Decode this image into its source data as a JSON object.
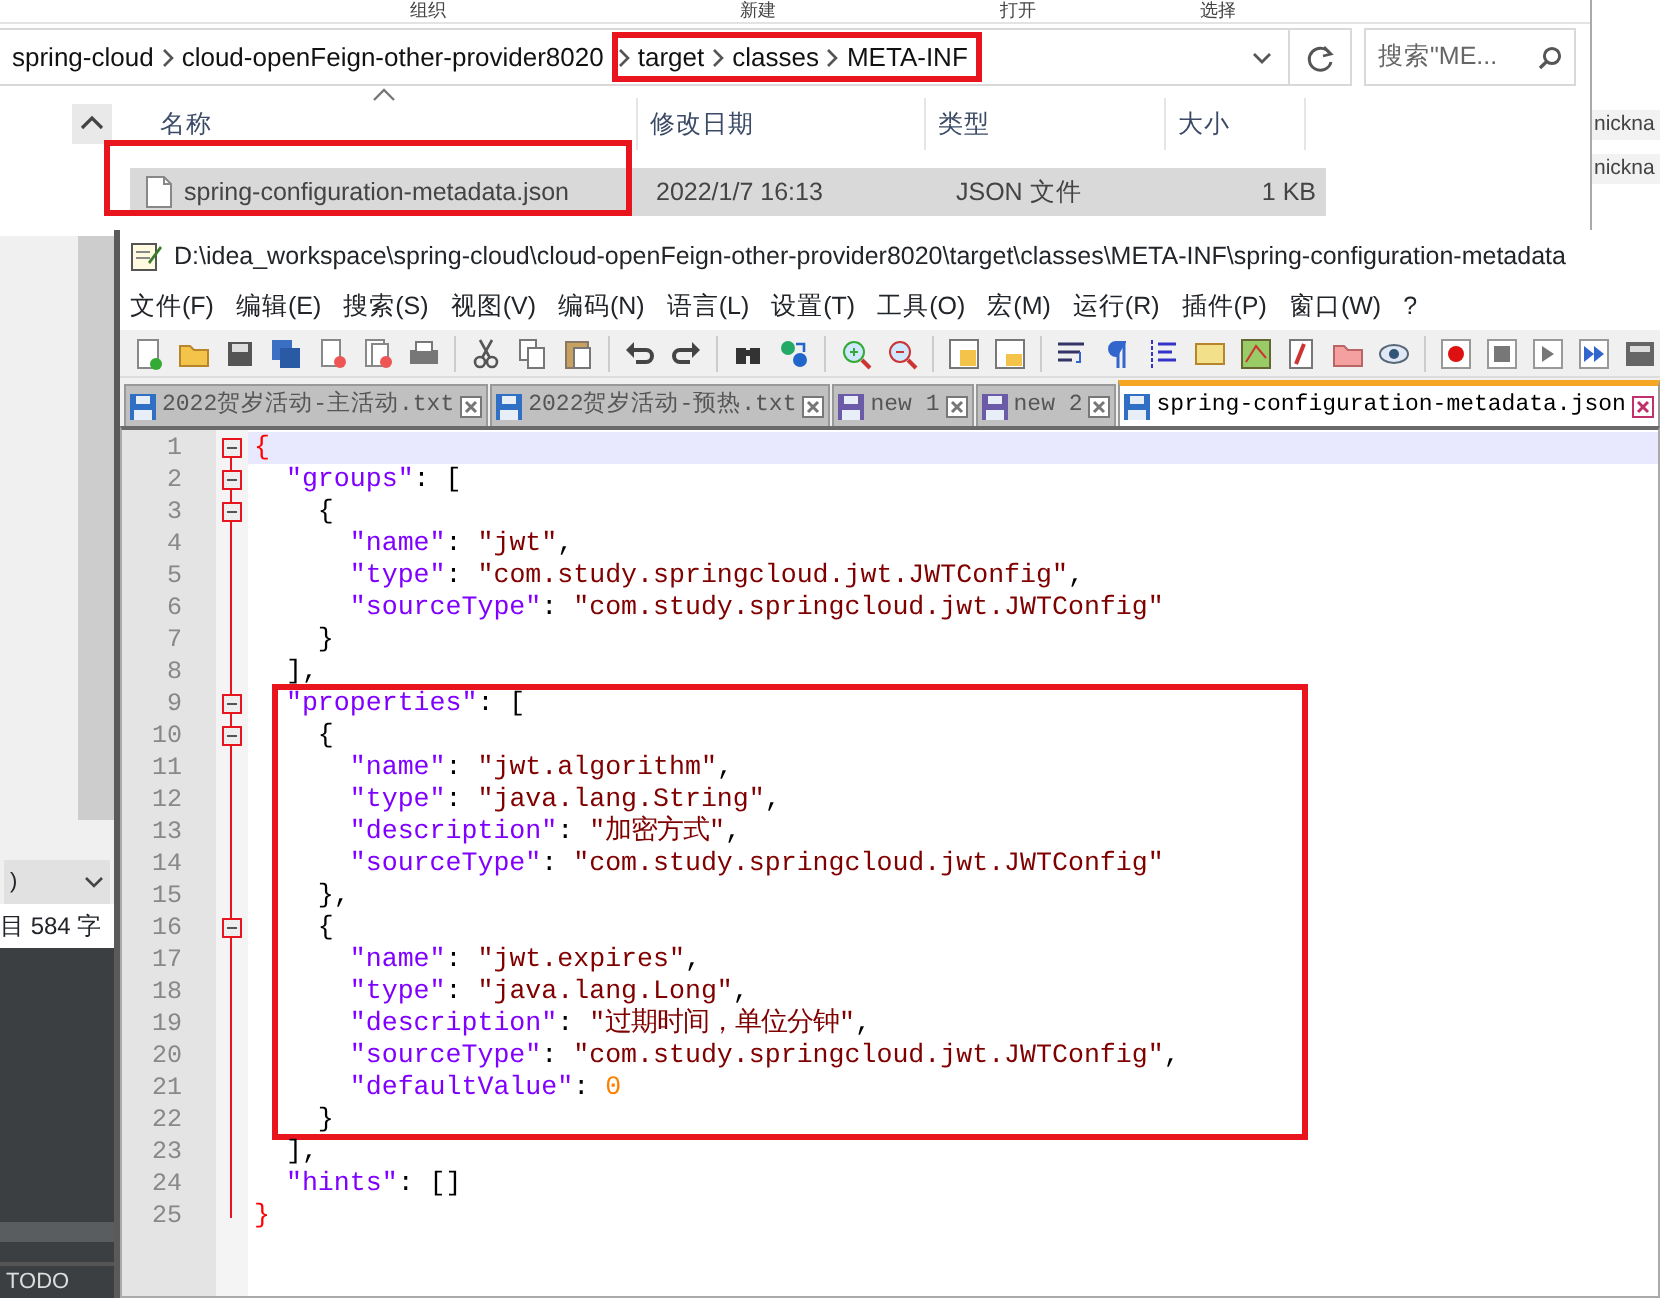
{
  "explorer": {
    "ribbon_labels": [
      "组织",
      "新建",
      "打开",
      "选择"
    ],
    "breadcrumb": [
      {
        "boxed": false,
        "items": [
          "spring-cloud",
          "cloud-openFeign-other-provider8020"
        ]
      },
      {
        "boxed": true,
        "items": [
          "target",
          "classes",
          "META-INF"
        ]
      }
    ],
    "search": {
      "placeholder": "搜索\"ME..."
    },
    "columns": [
      "名称",
      "修改日期",
      "类型",
      "大小"
    ],
    "files": [
      {
        "name": "spring-configuration-metadata.json",
        "modified": "2022/1/7 16:13",
        "type": "JSON 文件",
        "size": "1 KB",
        "selected": true,
        "boxed": true
      }
    ]
  },
  "side_window": {
    "items": [
      "nickna",
      "nickna"
    ]
  },
  "ide_fragment": {
    "dropdown": ")",
    "status": "目 584 字",
    "tool_tab": "TODO"
  },
  "editor": {
    "title": "D:\\idea_workspace\\spring-cloud\\cloud-openFeign-other-provider8020\\target\\classes\\META-INF\\spring-configuration-metadata",
    "menu": [
      "文件(F)",
      "编辑(E)",
      "搜索(S)",
      "视图(V)",
      "编码(N)",
      "语言(L)",
      "设置(T)",
      "工具(O)",
      "宏(M)",
      "运行(R)",
      "插件(P)",
      "窗口(W)",
      "?"
    ],
    "tabs": [
      {
        "label": "2022贺岁活动-主活动.txt",
        "selected": false,
        "saved": true
      },
      {
        "label": "2022贺岁活动-预热.txt",
        "selected": false,
        "saved": true
      },
      {
        "label": "new 1",
        "selected": false,
        "saved": false
      },
      {
        "label": "new 2",
        "selected": false,
        "saved": false
      },
      {
        "label": "spring-configuration-metadata.json",
        "selected": true,
        "saved": true
      }
    ],
    "sections": [
      {
        "boxed": false,
        "lines": [
          {
            "num": "1",
            "foldable": true,
            "current": true,
            "tokens": [
              {
                "kind": "brace",
                "text": "{"
              }
            ]
          },
          {
            "num": "2",
            "foldable": true,
            "current": false,
            "tokens": [
              {
                "kind": "key",
                "text": "  \"groups\""
              },
              {
                "kind": "punct",
                "text": ": ["
              }
            ]
          },
          {
            "num": "3",
            "foldable": true,
            "current": false,
            "tokens": [
              {
                "kind": "punct",
                "text": "    {"
              }
            ]
          },
          {
            "num": "4",
            "foldable": false,
            "current": false,
            "tokens": [
              {
                "kind": "key",
                "text": "      \"name\""
              },
              {
                "kind": "punct",
                "text": ": "
              },
              {
                "kind": "string",
                "text": "\"jwt\""
              },
              {
                "kind": "punct",
                "text": ","
              }
            ]
          },
          {
            "num": "5",
            "foldable": false,
            "current": false,
            "tokens": [
              {
                "kind": "key",
                "text": "      \"type\""
              },
              {
                "kind": "punct",
                "text": ": "
              },
              {
                "kind": "string",
                "text": "\"com.study.springcloud.jwt.JWTConfig\""
              },
              {
                "kind": "punct",
                "text": ","
              }
            ]
          },
          {
            "num": "6",
            "foldable": false,
            "current": false,
            "tokens": [
              {
                "kind": "key",
                "text": "      \"sourceType\""
              },
              {
                "kind": "punct",
                "text": ": "
              },
              {
                "kind": "string",
                "text": "\"com.study.springcloud.jwt.JWTConfig\""
              }
            ]
          },
          {
            "num": "7",
            "foldable": false,
            "current": false,
            "tokens": [
              {
                "kind": "punct",
                "text": "    }"
              }
            ]
          },
          {
            "num": "8",
            "foldable": false,
            "current": false,
            "tokens": [
              {
                "kind": "punct",
                "text": "  ],"
              }
            ]
          }
        ]
      },
      {
        "boxed": true,
        "lines": [
          {
            "num": "9",
            "foldable": true,
            "current": false,
            "tokens": [
              {
                "kind": "key",
                "text": "  \"properties\""
              },
              {
                "kind": "punct",
                "text": ": ["
              }
            ]
          },
          {
            "num": "10",
            "foldable": true,
            "current": false,
            "tokens": [
              {
                "kind": "punct",
                "text": "    {"
              }
            ]
          },
          {
            "num": "11",
            "foldable": false,
            "current": false,
            "tokens": [
              {
                "kind": "key",
                "text": "      \"name\""
              },
              {
                "kind": "punct",
                "text": ": "
              },
              {
                "kind": "string",
                "text": "\"jwt.algorithm\""
              },
              {
                "kind": "punct",
                "text": ","
              }
            ]
          },
          {
            "num": "12",
            "foldable": false,
            "current": false,
            "tokens": [
              {
                "kind": "key",
                "text": "      \"type\""
              },
              {
                "kind": "punct",
                "text": ": "
              },
              {
                "kind": "string",
                "text": "\"java.lang.String\""
              },
              {
                "kind": "punct",
                "text": ","
              }
            ]
          },
          {
            "num": "13",
            "foldable": false,
            "current": false,
            "tokens": [
              {
                "kind": "key",
                "text": "      \"description\""
              },
              {
                "kind": "punct",
                "text": ": "
              },
              {
                "kind": "string",
                "text": "\"加密方式\""
              },
              {
                "kind": "punct",
                "text": ","
              }
            ]
          },
          {
            "num": "14",
            "foldable": false,
            "current": false,
            "tokens": [
              {
                "kind": "key",
                "text": "      \"sourceType\""
              },
              {
                "kind": "punct",
                "text": ": "
              },
              {
                "kind": "string",
                "text": "\"com.study.springcloud.jwt.JWTConfig\""
              }
            ]
          },
          {
            "num": "15",
            "foldable": false,
            "current": false,
            "tokens": [
              {
                "kind": "punct",
                "text": "    },"
              }
            ]
          },
          {
            "num": "16",
            "foldable": true,
            "current": false,
            "tokens": [
              {
                "kind": "punct",
                "text": "    {"
              }
            ]
          },
          {
            "num": "17",
            "foldable": false,
            "current": false,
            "tokens": [
              {
                "kind": "key",
                "text": "      \"name\""
              },
              {
                "kind": "punct",
                "text": ": "
              },
              {
                "kind": "string",
                "text": "\"jwt.expires\""
              },
              {
                "kind": "punct",
                "text": ","
              }
            ]
          },
          {
            "num": "18",
            "foldable": false,
            "current": false,
            "tokens": [
              {
                "kind": "key",
                "text": "      \"type\""
              },
              {
                "kind": "punct",
                "text": ": "
              },
              {
                "kind": "string",
                "text": "\"java.lang.Long\""
              },
              {
                "kind": "punct",
                "text": ","
              }
            ]
          },
          {
            "num": "19",
            "foldable": false,
            "current": false,
            "tokens": [
              {
                "kind": "key",
                "text": "      \"description\""
              },
              {
                "kind": "punct",
                "text": ": "
              },
              {
                "kind": "string",
                "text": "\"过期时间，单位分钟\""
              },
              {
                "kind": "punct",
                "text": ","
              }
            ]
          },
          {
            "num": "20",
            "foldable": false,
            "current": false,
            "tokens": [
              {
                "kind": "key",
                "text": "      \"sourceType\""
              },
              {
                "kind": "punct",
                "text": ": "
              },
              {
                "kind": "string",
                "text": "\"com.study.springcloud.jwt.JWTConfig\""
              },
              {
                "kind": "punct",
                "text": ","
              }
            ]
          },
          {
            "num": "21",
            "foldable": false,
            "current": false,
            "tokens": [
              {
                "kind": "key",
                "text": "      \"defaultValue\""
              },
              {
                "kind": "punct",
                "text": ": "
              },
              {
                "kind": "number",
                "text": "0"
              }
            ]
          },
          {
            "num": "22",
            "foldable": false,
            "current": false,
            "tokens": [
              {
                "kind": "punct",
                "text": "    }"
              }
            ]
          }
        ]
      },
      {
        "boxed": false,
        "lines": [
          {
            "num": "23",
            "foldable": false,
            "current": false,
            "tokens": [
              {
                "kind": "punct",
                "text": "  ],"
              }
            ]
          },
          {
            "num": "24",
            "foldable": false,
            "current": false,
            "tokens": [
              {
                "kind": "key",
                "text": "  \"hints\""
              },
              {
                "kind": "punct",
                "text": ": []"
              }
            ]
          },
          {
            "num": "25",
            "foldable": false,
            "current": false,
            "tokens": [
              {
                "kind": "brace",
                "text": "}"
              }
            ]
          }
        ]
      }
    ]
  }
}
